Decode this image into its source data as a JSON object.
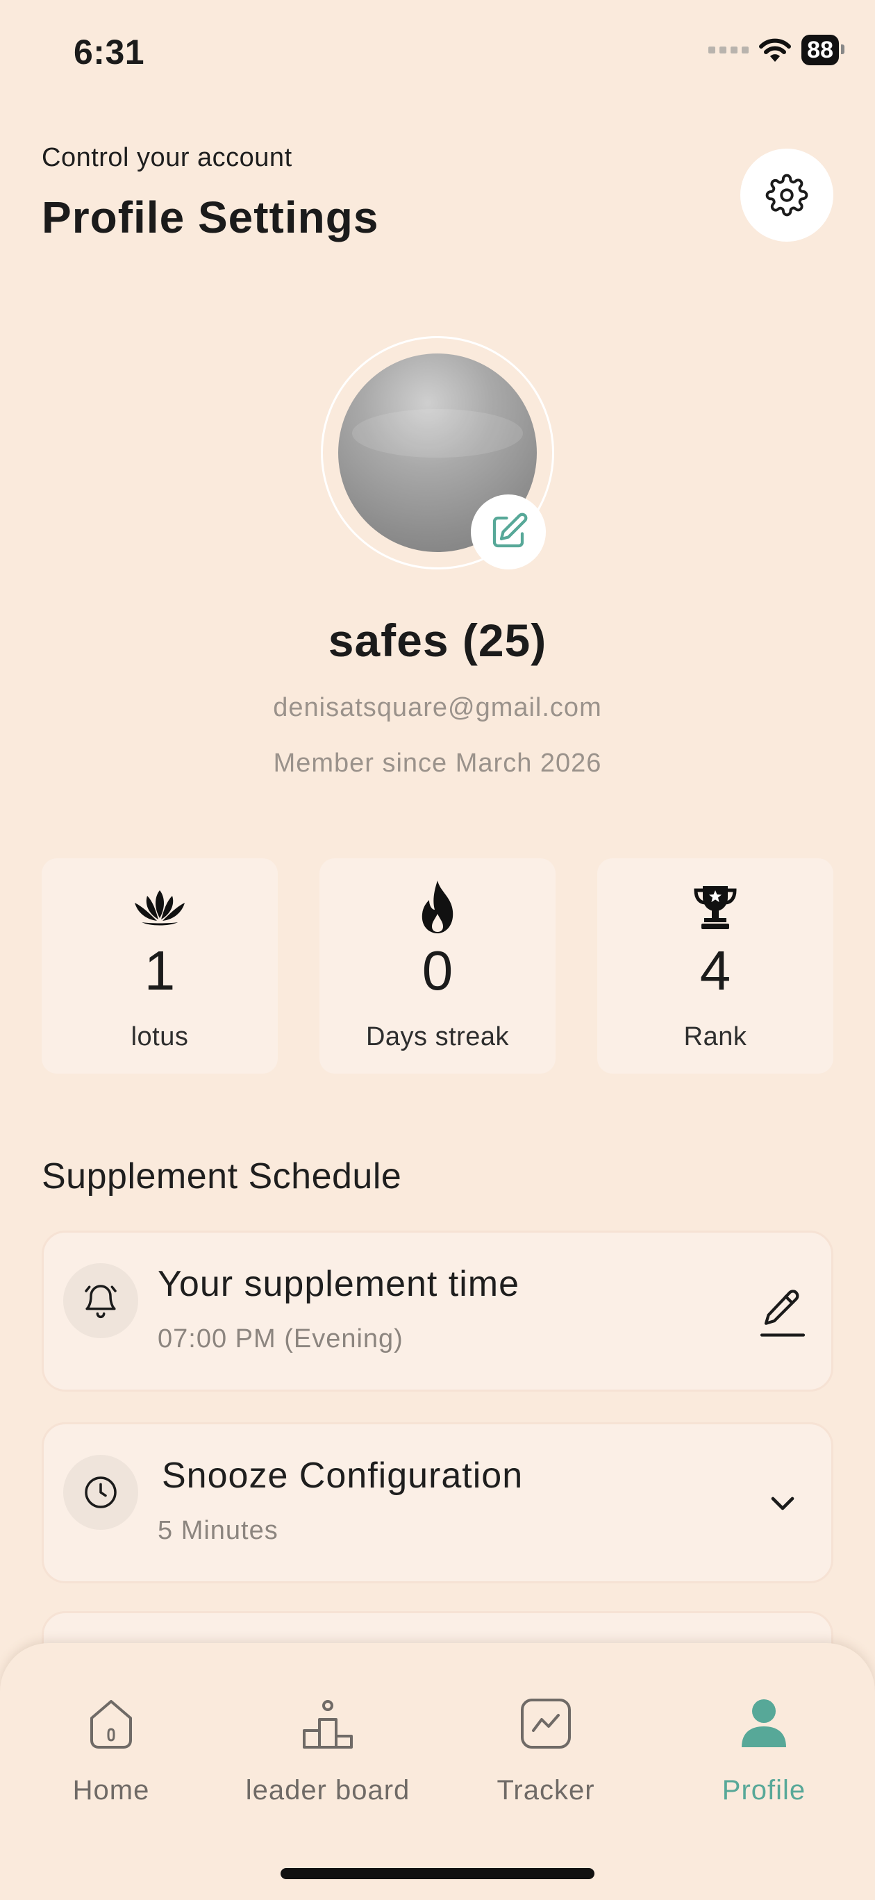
{
  "status_bar": {
    "time": "6:31",
    "battery": "88"
  },
  "header": {
    "subtitle": "Control your account",
    "title": "Profile Settings"
  },
  "profile": {
    "name": "safes (25)",
    "email": "denisatsquare@gmail.com",
    "member_since": "Member since March 2026"
  },
  "stats": [
    {
      "icon": "lotus-icon",
      "value": "1",
      "label": "lotus"
    },
    {
      "icon": "flame-icon",
      "value": "0",
      "label": "Days streak"
    },
    {
      "icon": "trophy-icon",
      "value": "4",
      "label": "Rank"
    }
  ],
  "schedule": {
    "section_title": "Supplement Schedule",
    "supplement": {
      "title": "Your supplement time",
      "subtitle": "07:00 PM (Evening)"
    },
    "snooze": {
      "title": "Snooze Configuration",
      "subtitle": "5 Minutes"
    }
  },
  "nav": {
    "items": [
      {
        "label": "Home",
        "icon": "home-icon"
      },
      {
        "label": "leader board",
        "icon": "podium-icon"
      },
      {
        "label": "Tracker",
        "icon": "chart-icon"
      },
      {
        "label": "Profile",
        "icon": "person-icon",
        "active": true
      }
    ]
  },
  "colors": {
    "background": "#FAEADC",
    "card": "#FBEFE6",
    "accent": "#57A898",
    "text": "#1B1B1B",
    "muted": "#9A928B"
  }
}
